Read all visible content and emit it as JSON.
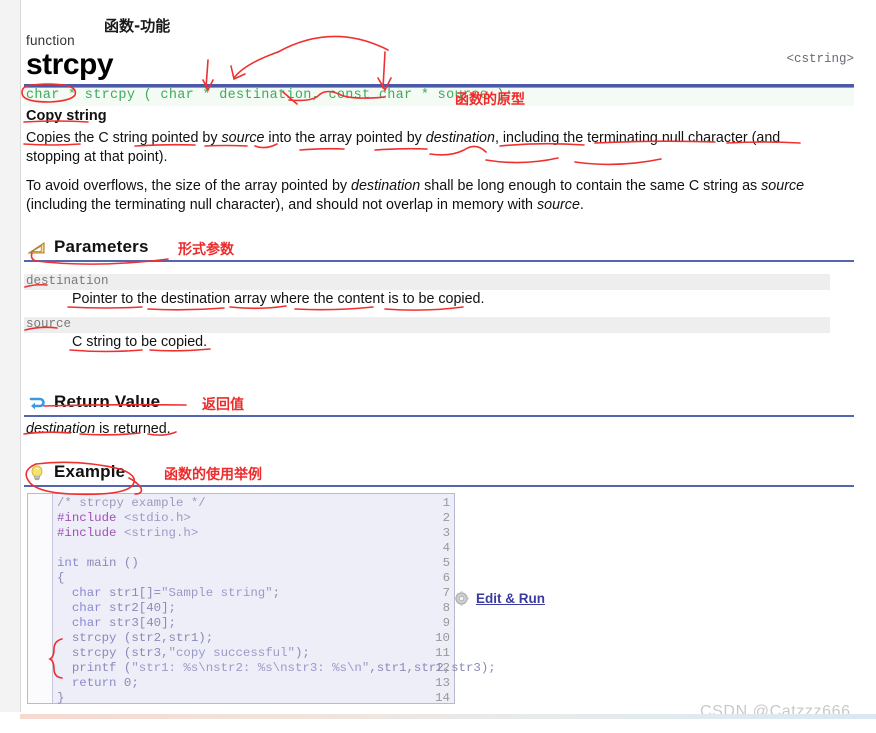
{
  "header": {
    "kind_label": "function",
    "kind_annotation_cn": "函数-功能",
    "title": "strcpy",
    "include": "<cstring>"
  },
  "prototype": {
    "code": "char * strcpy ( char * destination, const char * source );",
    "annotation_cn": "函数的原型"
  },
  "summary": {
    "heading": "Copy string",
    "paragraph1_a": "Copies the C string pointed by ",
    "paragraph1_src": "source",
    "paragraph1_b": " into the array pointed by ",
    "paragraph1_dst": "destination",
    "paragraph1_c": ", including the terminating null character (and stopping at that point).",
    "paragraph2_a": "To avoid overflows, the size of the array pointed by ",
    "paragraph2_dst": "destination",
    "paragraph2_b": " shall be long enough to contain the same C string as ",
    "paragraph2_src": "source",
    "paragraph2_c": " (including the terminating null character), and should not overlap in memory with ",
    "paragraph2_src2": "source",
    "paragraph2_d": "."
  },
  "sections": {
    "parameters": {
      "title": "Parameters",
      "annotation_cn": "形式参数",
      "icon": "ruler-triangle-icon",
      "items": [
        {
          "name": "destination",
          "description": "Pointer to the destination array where the content is to be copied."
        },
        {
          "name": "source",
          "description": "C string to be copied."
        }
      ]
    },
    "return_value": {
      "title": "Return Value",
      "annotation_cn": "返回值",
      "icon": "return-arrow-icon",
      "text_em": "destination",
      "text_rest": " is returned."
    },
    "example": {
      "title": "Example",
      "annotation_cn": "函数的使用举例",
      "icon": "lightbulb-icon",
      "edit_run_label": "Edit & Run",
      "edit_run_icon": "gear-icon",
      "line_numbers": [
        "1",
        "2",
        "3",
        "4",
        "5",
        "6",
        "7",
        "8",
        "9",
        "10",
        "11",
        "12",
        "13",
        "14"
      ],
      "code_lines": [
        "/* strcpy example */",
        "#include <stdio.h>",
        "#include <string.h>",
        "",
        "int main ()",
        "{",
        "  char str1[]=\"Sample string\";",
        "  char str2[40];",
        "  char str3[40];",
        "  strcpy (str2,str1);",
        "  strcpy (str3,\"copy successful\");",
        "  printf (\"str1: %s\\nstr2: %s\\nstr3: %s\\n\",str1,str2,str3);",
        "  return 0;",
        "}"
      ]
    }
  },
  "watermark": "CSDN @Catzzz666",
  "colors": {
    "rule_blue": "#5566b0",
    "prototype_green": "#3faa5e",
    "annotation_red": "#ee2b2b",
    "code_bg": "#eeeef8",
    "link_blue": "#3b3b9e"
  }
}
